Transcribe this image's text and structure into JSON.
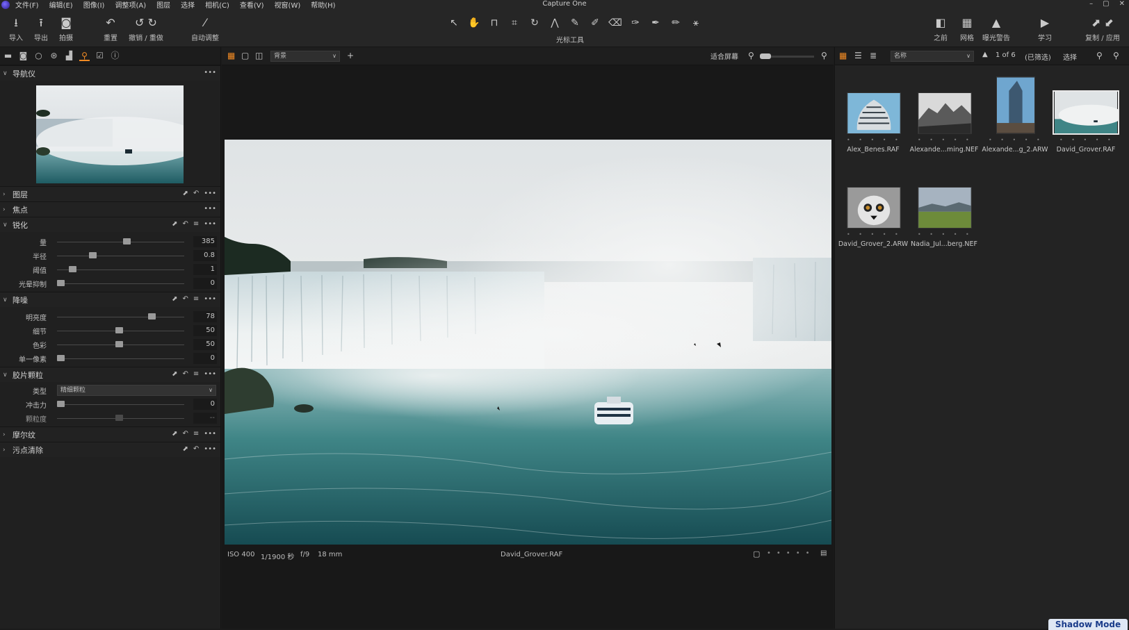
{
  "app": {
    "title": "Capture One",
    "window_controls": [
      "–",
      "▢",
      "✕"
    ]
  },
  "menu": [
    "文件(F)",
    "编辑(E)",
    "图像(I)",
    "调整项(A)",
    "图层",
    "选择",
    "相机(C)",
    "查看(V)",
    "视窗(W)",
    "帮助(H)"
  ],
  "toolbar": {
    "import": "导入",
    "export": "导出",
    "capture": "拍摄",
    "reset": "重置",
    "undo_redo": "撤销 / 重做",
    "auto_adjust": "自动调整",
    "cursor_tools_label": "光标工具",
    "before": "之前",
    "grid": "网格",
    "exposure_warning": "曝光警告",
    "learn": "学习",
    "copy_apply": "复制 / 应用"
  },
  "left_panel": {
    "navigator": {
      "title": "导航仪"
    },
    "layers": {
      "title": "图层"
    },
    "focus": {
      "title": "焦点"
    },
    "sharpening": {
      "title": "锐化",
      "sliders": [
        {
          "label": "量",
          "value": "385",
          "pct": 0.55
        },
        {
          "label": "半径",
          "value": "0.8",
          "pct": 0.27
        },
        {
          "label": "阈值",
          "value": "1",
          "pct": 0.1
        },
        {
          "label": "光晕抑制",
          "value": "0",
          "pct": 0.0
        }
      ]
    },
    "noise_reduction": {
      "title": "降噪",
      "sliders": [
        {
          "label": "明亮度",
          "value": "78",
          "pct": 0.76
        },
        {
          "label": "细节",
          "value": "50",
          "pct": 0.49
        },
        {
          "label": "色彩",
          "value": "50",
          "pct": 0.49
        },
        {
          "label": "单一像素",
          "value": "0",
          "pct": 0.0
        }
      ]
    },
    "film_grain": {
      "title": "胶片颗粒",
      "type_label": "类型",
      "type_value": "精细颗粒",
      "impact": {
        "label": "冲击力",
        "value": "0",
        "pct": 0.0
      },
      "granularity": {
        "label": "颗粒度",
        "value": "--",
        "pct": 0.49
      }
    },
    "moire": {
      "title": "摩尔纹"
    },
    "spot_removal": {
      "title": "污点清除"
    }
  },
  "viewer": {
    "background_select": "背景",
    "fit_label": "适合屏幕",
    "zoom_pct": 0.2,
    "info": {
      "iso": "ISO 400",
      "shutter": "1/1900 秒",
      "aperture": "f/9",
      "focal": "18 mm",
      "filename": "David_Grover.RAF"
    }
  },
  "browser": {
    "sort_select": "名称",
    "count": "1 of 6",
    "filtered": "(已筛选)",
    "select_label": "选择",
    "thumbs": [
      {
        "name": "Alex_Benes.RAF",
        "stars": "• • • • •"
      },
      {
        "name": "Alexande...ming.NEF",
        "stars": "• • • • •"
      },
      {
        "name": "Alexande...g_2.ARW",
        "stars": "• • • • •"
      },
      {
        "name": "David_Grover.RAF",
        "stars": "• • • • •"
      },
      {
        "name": "David_Grover_2.ARW",
        "stars": "• • • • •"
      },
      {
        "name": "Nadia_Jul...berg.NEF",
        "stars": "• • • • •"
      }
    ]
  },
  "shadow_mode": "Shadow Mode",
  "colors": {
    "accent": "#f08a24",
    "panel": "#202020",
    "viewer_bg": "#181818"
  }
}
